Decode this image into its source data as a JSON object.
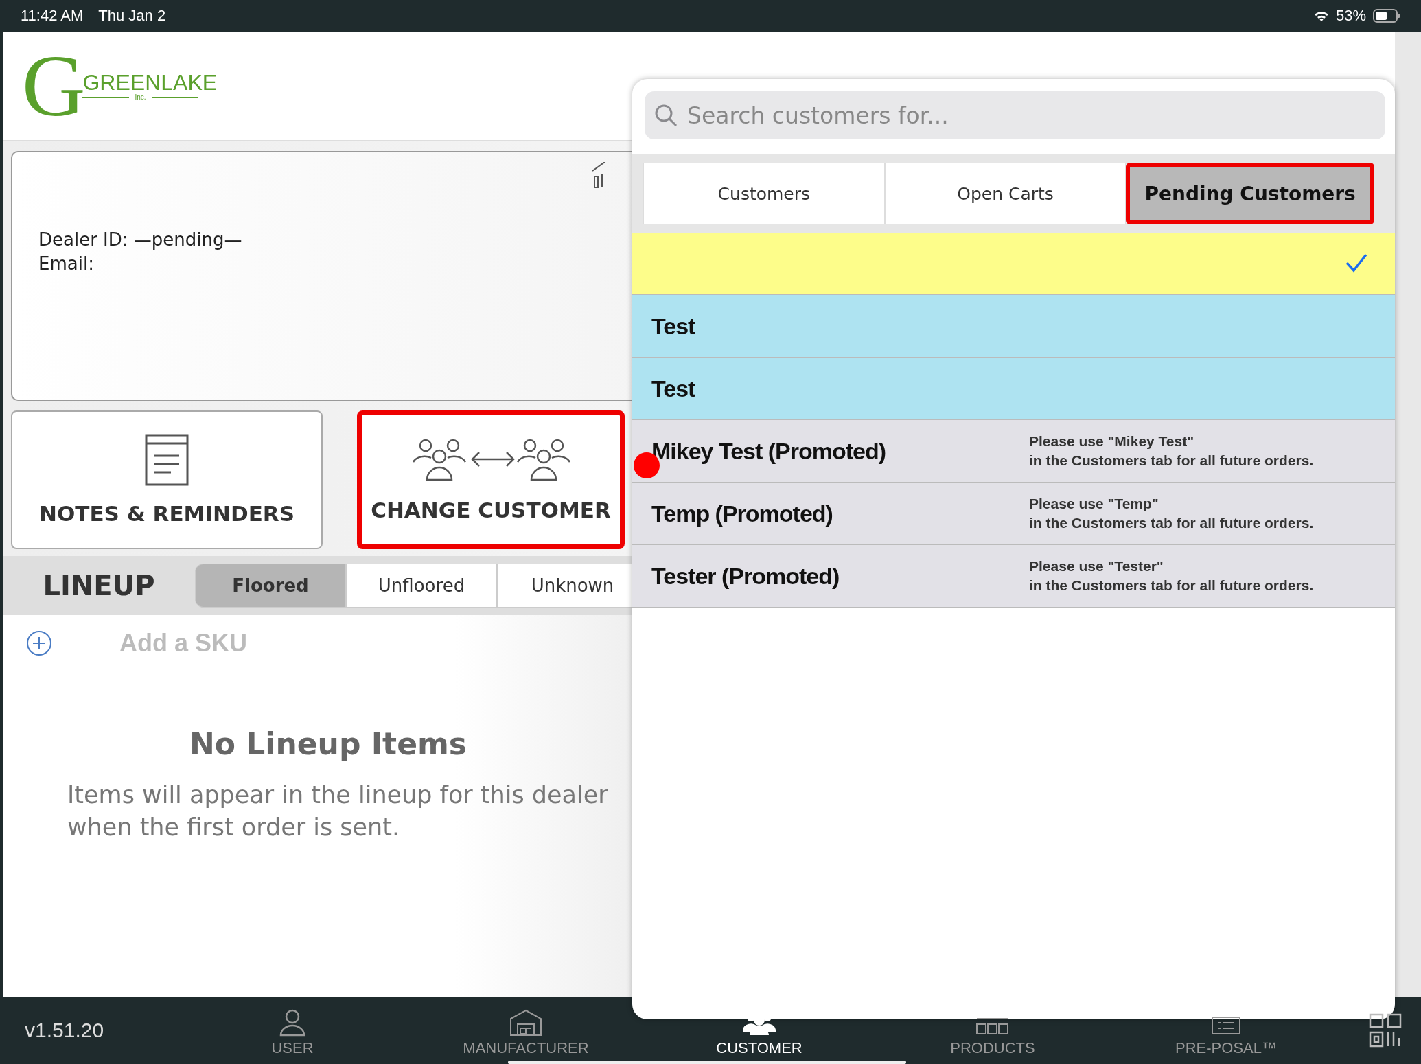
{
  "status_bar": {
    "time": "11:42 AM",
    "date": "Thu Jan 2",
    "battery": "53%"
  },
  "logo": {
    "initial": "G",
    "name": "GREENLAKE",
    "suffix": "Inc."
  },
  "dealer": {
    "id_line": "Dealer ID: —pending—",
    "email_line": "Email:"
  },
  "actions": [
    {
      "label": "NOTES & REMINDERS",
      "kind": "notes",
      "highlighted": false
    },
    {
      "label": "CHANGE CUSTOMER",
      "kind": "change",
      "highlighted": true
    }
  ],
  "lineup": {
    "title": "LINEUP",
    "tabs": [
      {
        "label": "Floored",
        "selected": true
      },
      {
        "label": "Unfloored",
        "selected": false
      },
      {
        "label": "Unknown",
        "selected": false
      }
    ],
    "add_sku": "Add a SKU",
    "empty_title": "No Lineup Items",
    "empty_text": "Items will appear in the lineup for this dealer when the first order is sent."
  },
  "popover": {
    "search": {
      "placeholder": "Search customers for..."
    },
    "tabs": [
      {
        "label": "Customers",
        "selected": false,
        "highlighted": false
      },
      {
        "label": "Open Carts",
        "selected": false,
        "highlighted": false
      },
      {
        "label": "Pending Customers",
        "selected": true,
        "highlighted": true
      }
    ],
    "rows": [
      {
        "name": "",
        "color": "#fdfd8a",
        "selected": true
      },
      {
        "name": "Test",
        "color": "#aee3f1",
        "selected": false
      },
      {
        "name": "Test",
        "color": "#aee3f1",
        "selected": false
      },
      {
        "name": "Mikey Test (Promoted)",
        "note": [
          "Please use \"Mikey Test\"",
          "in the Customers tab for all future orders."
        ],
        "color": "#e2e1e7",
        "selected": false
      },
      {
        "name": "Temp (Promoted)",
        "note": [
          "Please use \"Temp\"",
          "in the Customers tab for all future orders."
        ],
        "color": "#e2e1e7",
        "selected": false
      },
      {
        "name": "Tester (Promoted)",
        "note": [
          "Please use \"Tester\"",
          "in the Customers tab for all future orders."
        ],
        "color": "#e2e1e7",
        "selected": false
      }
    ]
  },
  "bottom_bar": {
    "version": "v1.51.20",
    "items": [
      {
        "label": "USER",
        "kind": "user",
        "selected": false
      },
      {
        "label": "MANUFACTURER",
        "kind": "building",
        "selected": false
      },
      {
        "label": "CUSTOMER",
        "kind": "people",
        "selected": true
      },
      {
        "label": "PRODUCTS",
        "kind": "grid",
        "selected": false
      },
      {
        "label": "PRE-POSAL™",
        "kind": "list",
        "selected": false
      }
    ]
  }
}
